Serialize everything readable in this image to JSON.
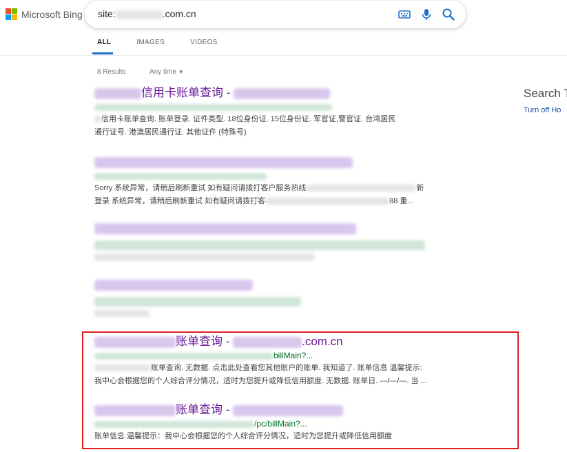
{
  "logo": {
    "text": "Microsoft Bing"
  },
  "search": {
    "prefix": "site:",
    "suffix": ".com.cn"
  },
  "icons": {
    "keyboard": "keyboard-icon",
    "mic": "microphone-icon",
    "search": "search-icon"
  },
  "tabs": [
    {
      "label": "ALL",
      "active": true
    },
    {
      "label": "IMAGES",
      "active": false
    },
    {
      "label": "VIDEOS",
      "active": false
    }
  ],
  "results_info": {
    "count": "8 Results",
    "filter": "Any time"
  },
  "results": [
    {
      "title_suffix": "信用卡账单查询 - ",
      "snippet_1": "信用卡账单查询. 账单登录. 证件类型. 18位身份证. 15位身份证. 军官证,警官证. 台湾居民",
      "snippet_2": "通行证号. 港澳居民通行证. 其他证件 (特殊号)"
    },
    {
      "snippet_1": "Sorry 系统异常，请稍后刷新重试 如有疑问请拨打客户服务热线",
      "snippet_1_end": "新",
      "snippet_2": "登录 系统异常，请稍后刷新重试 如有疑问请拨打客",
      "snippet_2_end": "88 重..."
    },
    {},
    {},
    {
      "title_mid": "账单查询 - ",
      "title_end": ".com.cn",
      "url_end": "billMain?...",
      "snippet_1": "账单查询. 无数据. 点击此处查看您其他账户的账单. 我知道了. 账单信息 温馨提示:",
      "snippet_2": "我中心会根据您的个人综合评分情况，适时为您提升或降低信用额度. 无数据. 账单日. —/—/—. 当 ..."
    },
    {
      "title_mid": "账单查询 - ",
      "url_end": "/pc/billMain?...",
      "snippet_1": "账单信息 温馨提示：我中心会根据您的个人综合评分情况，适时为您提升或降低信用额度"
    }
  ],
  "sidebar": {
    "title": "Search T",
    "link": "Turn off Ho"
  },
  "colors": {
    "accent": "#1e6fca",
    "title": "#6a1b9a",
    "url": "#006d21",
    "highlight_box": "#e02020",
    "ms_red": "#f25022",
    "ms_green": "#7fba00",
    "ms_blue": "#00a4ef",
    "ms_yellow": "#ffb900"
  }
}
